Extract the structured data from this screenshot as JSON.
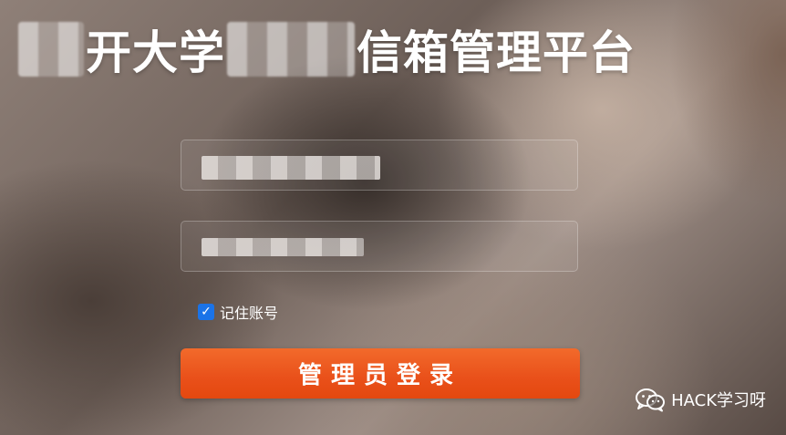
{
  "header": {
    "title_part1": "开大学",
    "title_part2": "信箱管理平台"
  },
  "login": {
    "remember_label": "记住账号",
    "remember_checked": true,
    "submit_label": "管理员登录"
  },
  "watermark": {
    "text": "HACK学习呀",
    "icon": "wechat-icon"
  }
}
